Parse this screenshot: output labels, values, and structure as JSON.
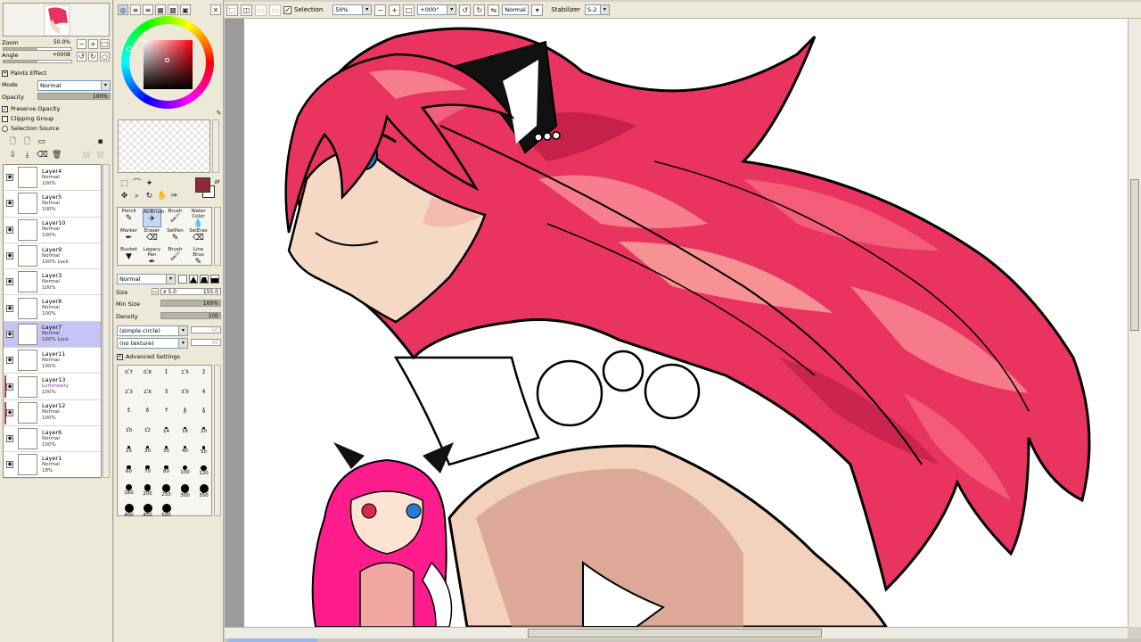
{
  "toolbar": {
    "selection_label": "Selection",
    "zoom_value": "50%",
    "rotation_value": "+000°",
    "blend_mode": "Normal",
    "stabilizer_label": "Stabilizer",
    "stabilizer_value": "S-2"
  },
  "navigator": {
    "zoom_label": "Zoom",
    "zoom_value": "50.0%",
    "angle_label": "Angle",
    "angle_value": "+0008"
  },
  "paint_effect": {
    "section_label": "Paints Effect",
    "mode_label": "Mode",
    "mode_value": "Normal",
    "opacity_label": "Opacity",
    "opacity_value": "100%",
    "opacity": 1.0
  },
  "layer_options": {
    "preserve_opacity": "Preserve Opacity",
    "clipping_group": "Clipping Group",
    "selection_source": "Selection Source"
  },
  "layers": [
    {
      "name": "Layer4",
      "mode": "Normal",
      "opacity": "100%",
      "selected": false,
      "clipped": false
    },
    {
      "name": "Layer5",
      "mode": "Normal",
      "opacity": "100%",
      "selected": false,
      "clipped": false
    },
    {
      "name": "Layer10",
      "mode": "Normal",
      "opacity": "100%",
      "selected": false,
      "clipped": false
    },
    {
      "name": "Layer9",
      "mode": "Normal",
      "opacity": "100% Lock",
      "selected": false,
      "clipped": false
    },
    {
      "name": "Layer3",
      "mode": "Normal",
      "opacity": "100%",
      "selected": false,
      "clipped": false
    },
    {
      "name": "Layer8",
      "mode": "Normal",
      "opacity": "100%",
      "selected": false,
      "clipped": false
    },
    {
      "name": "Layer7",
      "mode": "Normal",
      "opacity": "100% Lock",
      "selected": true,
      "clipped": false
    },
    {
      "name": "Layer11",
      "mode": "Normal",
      "opacity": "100%",
      "selected": false,
      "clipped": false
    },
    {
      "name": "Layer13",
      "mode": "Luminosity",
      "opacity": "100%",
      "selected": false,
      "clipped": true
    },
    {
      "name": "Layer12",
      "mode": "Normal",
      "opacity": "100%",
      "selected": false,
      "clipped": true
    },
    {
      "name": "Layer6",
      "mode": "Normal",
      "opacity": "100%",
      "selected": false,
      "clipped": false
    },
    {
      "name": "Layer1",
      "mode": "Normal",
      "opacity": "18%",
      "selected": false,
      "clipped": false
    }
  ],
  "colors": {
    "foreground": "#8e2a3a",
    "background": "#ffffff",
    "selected_layer": "#c6c3f5",
    "hair_main": "#e8345f",
    "skin": "#f5d9c4"
  },
  "brushes": [
    {
      "label": "Pencil",
      "icon": "pencil-icon",
      "selected": false
    },
    {
      "label": "AirBrush",
      "icon": "airbrush-icon",
      "selected": true
    },
    {
      "label": "Brush",
      "icon": "brush-icon",
      "selected": false
    },
    {
      "label": "Water Color",
      "icon": "watercolor-icon",
      "selected": false
    },
    {
      "label": "Marker",
      "icon": "marker-icon",
      "selected": false
    },
    {
      "label": "Eraser",
      "icon": "eraser-icon",
      "selected": false
    },
    {
      "label": "SelPen",
      "icon": "selpen-icon",
      "selected": false
    },
    {
      "label": "SelEras",
      "icon": "seleras-icon",
      "selected": false
    },
    {
      "label": "Bucket",
      "icon": "bucket-icon",
      "selected": false
    },
    {
      "label": "Legacy Pen",
      "icon": "legacy-pen-icon",
      "selected": false
    },
    {
      "label": "Brush",
      "icon": "brush-icon",
      "selected": false
    },
    {
      "label": "Line Brus",
      "icon": "line-brush-icon",
      "selected": false
    }
  ],
  "brush_settings": {
    "blend_mode": "Normal",
    "size_label": "Size",
    "size_multiplier": "x 5.0",
    "size_value": "155.0",
    "min_size_label": "Min Size",
    "min_size_value": "100%",
    "min_size": 1.0,
    "density_label": "Density",
    "density_value": "100",
    "density": 1.0,
    "shape_value": "(simple circle)",
    "shape_amount": "50",
    "texture_value": "(no texture)",
    "texture_amount": "95",
    "advanced_label": "Advanced Settings"
  },
  "brush_sizes": [
    "0.7",
    "0.8",
    "1",
    "1.5",
    "2",
    "2.3",
    "2.6",
    "3",
    "3.5",
    "4",
    "5",
    "6",
    "7",
    "8",
    "9",
    "10",
    "12",
    "14",
    "16",
    "20",
    "25",
    "30",
    "35",
    "40",
    "50",
    "60",
    "70",
    "80",
    "100",
    "120",
    "160",
    "200",
    "250",
    "300",
    "350",
    "400",
    "450",
    "500"
  ]
}
